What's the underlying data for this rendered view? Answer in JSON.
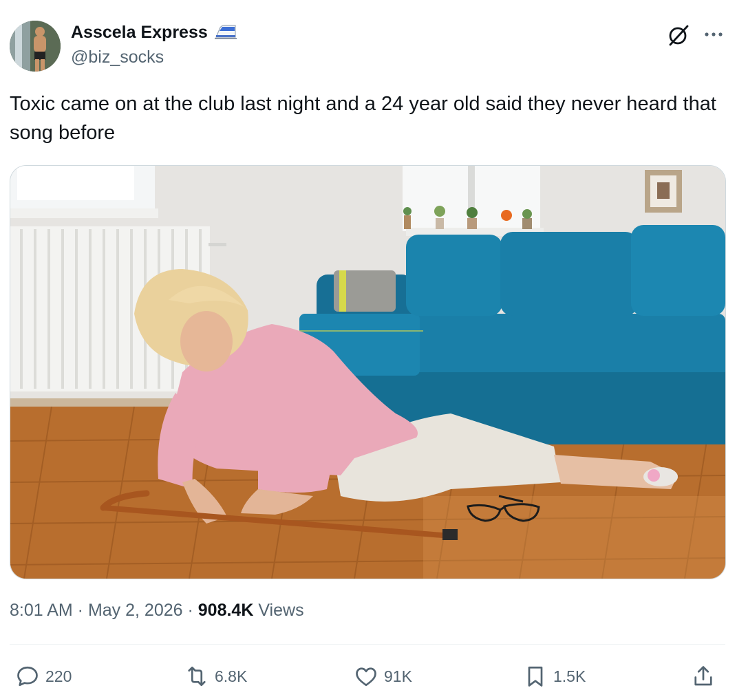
{
  "author": {
    "display_name": "Asscela Express",
    "handle": "@biz_socks",
    "badge_icon": "bullet-train-emoji",
    "avatar_icon": "avatar-photo"
  },
  "header_icons": {
    "grok": "grok-icon",
    "more": "more-icon"
  },
  "tweet": {
    "text": "Toxic came on at the club last night and a 24 year old said they never heard that song before"
  },
  "media": {
    "kind": "photo"
  },
  "meta": {
    "time": "8:01 AM",
    "separator1": " · ",
    "date": "May 2, 2026",
    "separator2": " · ",
    "views_count": "908.4K",
    "views_label": " Views"
  },
  "actions": {
    "replies": {
      "icon": "reply-icon",
      "count": "220"
    },
    "reposts": {
      "icon": "repost-icon",
      "count": "6.8K"
    },
    "likes": {
      "icon": "heart-icon",
      "count": "91K"
    },
    "bookmarks": {
      "icon": "bookmark-icon",
      "count": "1.5K"
    },
    "share": {
      "icon": "share-icon"
    }
  },
  "colors": {
    "text_primary": "#0f1419",
    "text_secondary": "#536471",
    "border": "#cfd9de",
    "sofa": "#1a7fa8",
    "floor": "#b06a2a",
    "shirt": "#e9a8b8"
  }
}
